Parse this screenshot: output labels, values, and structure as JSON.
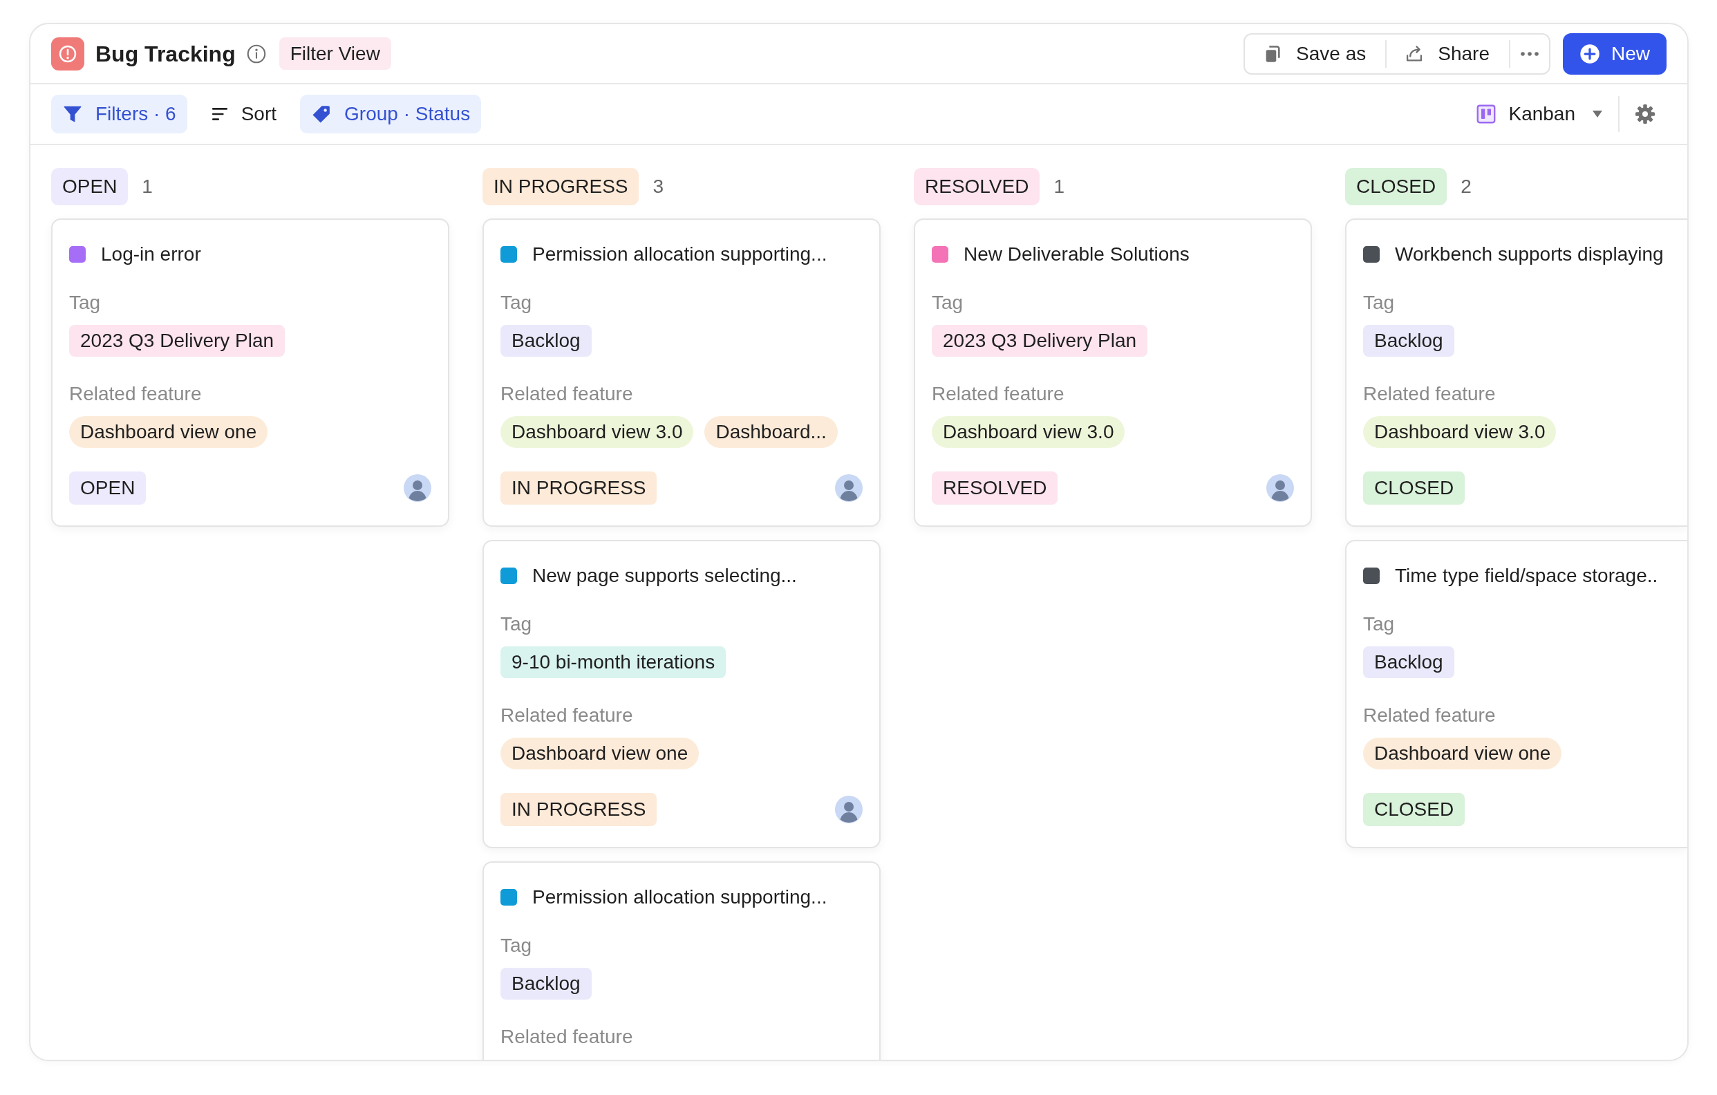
{
  "window": {
    "title": "Bug Tracking",
    "badge": "Filter View"
  },
  "header_actions": {
    "buttons": [
      {
        "kind": "save_as",
        "label": "Save as"
      },
      {
        "kind": "share",
        "label": "Share"
      }
    ],
    "primary": {
      "label": "New"
    }
  },
  "toolbar": {
    "buttons": [
      {
        "kind": "filter",
        "label": "Filters · 6",
        "active": true
      },
      {
        "kind": "sort",
        "label": "Sort",
        "active": false
      },
      {
        "kind": "group",
        "label": "Group · Status",
        "active": true
      }
    ],
    "view_switcher": {
      "label": "Kanban"
    }
  },
  "columns": [
    {
      "status": "OPEN",
      "count": "1",
      "color": "#eeeafd",
      "cards": [
        {
          "title": "Log-in error",
          "color": "#a66ef6",
          "tag_label": "Tag",
          "tags": [
            {
              "label": "2023 Q3 Delivery Plan",
              "color": "#fde4ee"
            }
          ],
          "feature_label": "Related feature",
          "features": [
            {
              "label": "Dashboard view one",
              "color": "#fdebd9"
            }
          ],
          "status": {
            "label": "OPEN",
            "color": "#eeeafd"
          },
          "avatar": true
        }
      ]
    },
    {
      "status": "IN PROGRESS",
      "count": "3",
      "color": "#fdead8",
      "cards": [
        {
          "title": "Permission allocation supporting...",
          "color": "#0e9bd8",
          "tag_label": "Tag",
          "tags": [
            {
              "label": "Backlog",
              "color": "#e9e9fb"
            }
          ],
          "feature_label": "Related feature",
          "features": [
            {
              "label": "Dashboard view 3.0",
              "color": "#eef6da"
            },
            {
              "label": "Dashboard...",
              "color": "#fdebd9"
            }
          ],
          "status": {
            "label": "IN PROGRESS",
            "color": "#fdead8"
          },
          "avatar": true
        },
        {
          "title": "New page supports selecting...",
          "color": "#0e9bd8",
          "tag_label": "Tag",
          "tags": [
            {
              "label": "9-10 bi-month iterations",
              "color": "#d9f3ee"
            }
          ],
          "feature_label": "Related feature",
          "features": [
            {
              "label": "Dashboard view one",
              "color": "#fdebd9"
            }
          ],
          "status": {
            "label": "IN PROGRESS",
            "color": "#fdead8"
          },
          "avatar": true
        },
        {
          "title": "Permission allocation supporting...",
          "color": "#0e9bd8",
          "tag_label": "Tag",
          "tags": [
            {
              "label": "Backlog",
              "color": "#e9e9fb"
            }
          ],
          "feature_label": "Related feature"
        }
      ]
    },
    {
      "status": "RESOLVED",
      "count": "1",
      "color": "#fde4ef",
      "cards": [
        {
          "title": "New Deliverable Solutions",
          "color": "#f472b6",
          "tag_label": "Tag",
          "tags": [
            {
              "label": "2023 Q3 Delivery Plan",
              "color": "#fde4ee"
            }
          ],
          "feature_label": "Related feature",
          "features": [
            {
              "label": "Dashboard view 3.0",
              "color": "#eef6da"
            }
          ],
          "status": {
            "label": "RESOLVED",
            "color": "#fde4ef"
          },
          "avatar": true
        }
      ]
    },
    {
      "status": "CLOSED",
      "count": "2",
      "color": "#d9f2da",
      "cards": [
        {
          "title": "Workbench supports displaying",
          "color": "#4b5057",
          "tag_label": "Tag",
          "tags": [
            {
              "label": "Backlog",
              "color": "#e9e9fb"
            }
          ],
          "feature_label": "Related feature",
          "features": [
            {
              "label": "Dashboard view 3.0",
              "color": "#eef6da"
            }
          ],
          "status": {
            "label": "CLOSED",
            "color": "#d9f2da"
          },
          "avatar": false
        },
        {
          "title": "Time type field/space storage..",
          "color": "#4b5057",
          "tag_label": "Tag",
          "tags": [
            {
              "label": "Backlog",
              "color": "#e9e9fb"
            }
          ],
          "feature_label": "Related feature",
          "features": [
            {
              "label": "Dashboard view one",
              "color": "#fdebd9"
            }
          ],
          "status": {
            "label": "CLOSED",
            "color": "#d9f2da"
          },
          "avatar": false
        }
      ]
    }
  ]
}
